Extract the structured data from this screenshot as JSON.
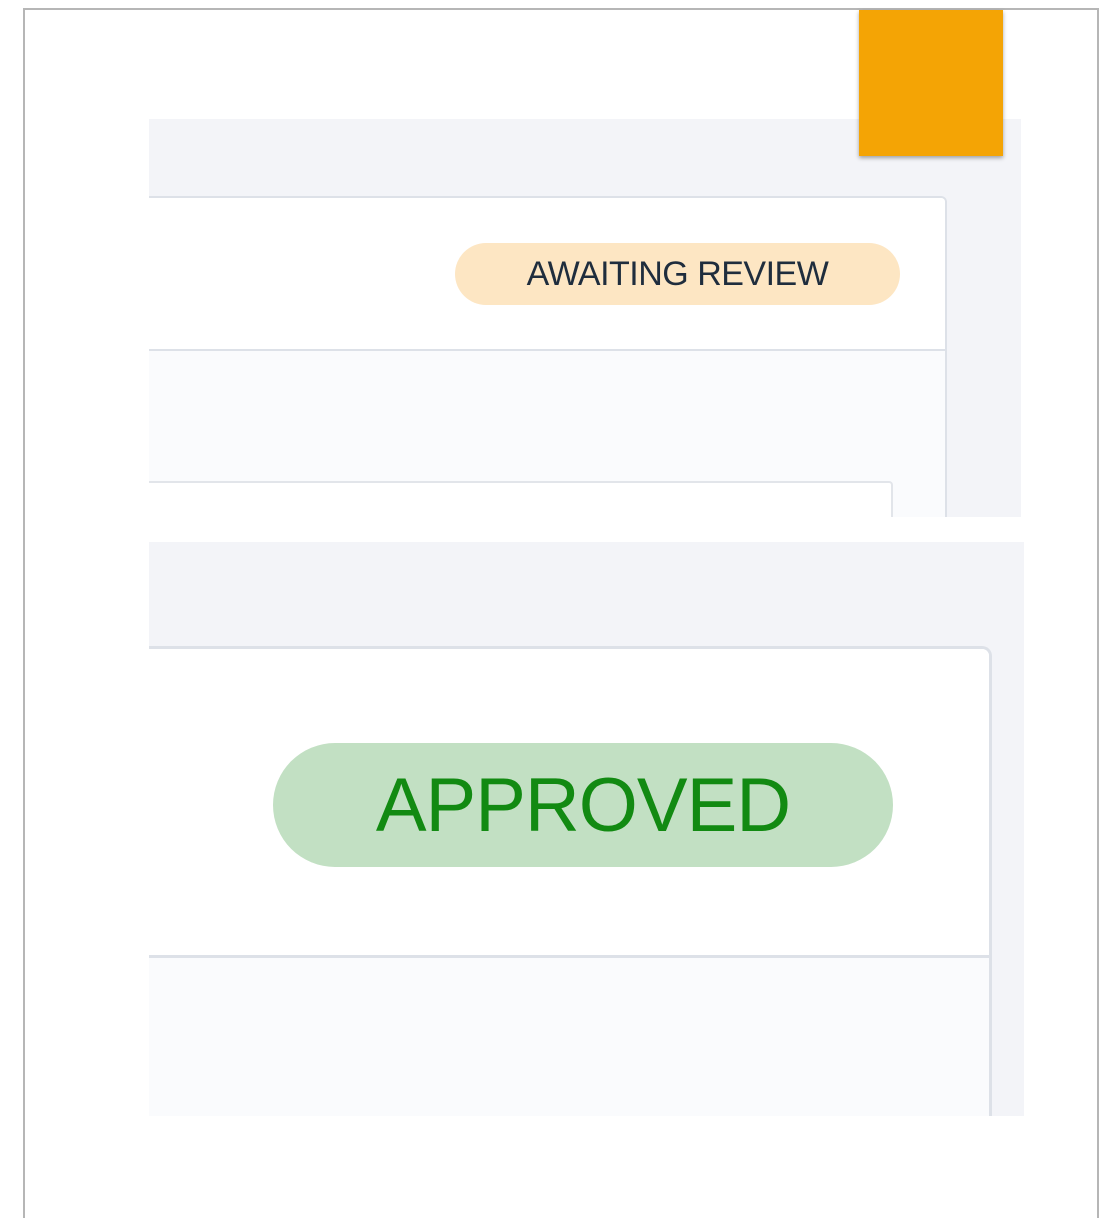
{
  "theme": {
    "panel_bg": "#f3f4f8",
    "card_body_bg": "#fafbfd",
    "accent": "#f4a405"
  },
  "top_panel": {
    "status_badge": {
      "label": "AWAITING REVIEW",
      "bg": "#fde6c3",
      "fg": "#1f2d3d"
    }
  },
  "bottom_panel": {
    "status_badge": {
      "label": "APPROVED",
      "bg": "#c2e0c3",
      "fg": "#128a12"
    }
  }
}
